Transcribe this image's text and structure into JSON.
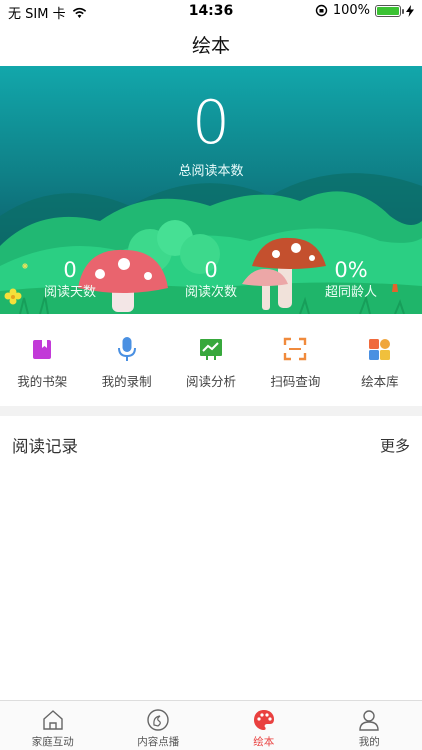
{
  "status_bar": {
    "carrier": "无 SIM 卡",
    "time": "14:36",
    "battery_percent": "100%",
    "battery_level": 1.0
  },
  "nav": {
    "title": "绘本"
  },
  "hero": {
    "total_value": "0",
    "total_label": "总阅读本数",
    "stats": [
      {
        "value": "0",
        "label": "阅读天数"
      },
      {
        "value": "0",
        "label": "阅读次数"
      },
      {
        "value": "0%",
        "label": "超同龄人"
      }
    ]
  },
  "features": [
    {
      "label": "我的书架",
      "icon": "bookshelf-icon",
      "color": "#c23ad8"
    },
    {
      "label": "我的录制",
      "icon": "microphone-icon",
      "color": "#4a90e2"
    },
    {
      "label": "阅读分析",
      "icon": "analysis-chart-icon",
      "color": "#37a83c"
    },
    {
      "label": "扫码查询",
      "icon": "scan-icon",
      "color": "#f08a3c"
    },
    {
      "label": "绘本库",
      "icon": "library-icon",
      "color": "#f0a63c"
    }
  ],
  "records": {
    "title": "阅读记录",
    "more": "更多"
  },
  "tabbar": {
    "tabs": [
      {
        "label": "家庭互动",
        "icon": "home-icon",
        "active": false
      },
      {
        "label": "内容点播",
        "icon": "content-play-icon",
        "active": false
      },
      {
        "label": "绘本",
        "icon": "palette-icon",
        "active": true
      },
      {
        "label": "我的",
        "icon": "profile-icon",
        "active": false
      }
    ],
    "active_color": "#e9403f"
  }
}
